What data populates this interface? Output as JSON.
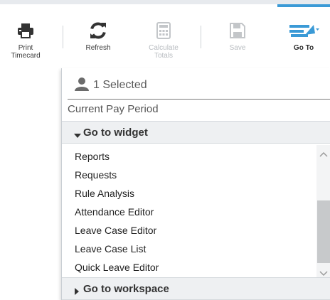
{
  "toolbar": {
    "print_label_1": "Print",
    "print_label_2": "Timecard",
    "refresh_label": "Refresh",
    "calculate_label_1": "Calculate",
    "calculate_label_2": "Totals",
    "save_label": "Save",
    "goto_label": "Go To"
  },
  "icons": {
    "print": "printer-icon",
    "refresh": "refresh-icon",
    "calculate": "calculator-icon",
    "save": "save-icon",
    "goto": "go-to-arrow-icon"
  },
  "panel": {
    "selected_text": "1 Selected",
    "period_text": "Current Pay Period",
    "widget_header": "Go to widget",
    "workspace_header": "Go to workspace",
    "widget_items": [
      "Reports",
      "Requests",
      "Rule Analysis",
      "Attendance Editor",
      "Leave Case Editor",
      "Leave Case List",
      "Quick Leave Editor"
    ]
  },
  "colors": {
    "accent": "#3b9ad6",
    "icon_dark": "#333333",
    "icon_disabled": "#c3c6c9"
  }
}
